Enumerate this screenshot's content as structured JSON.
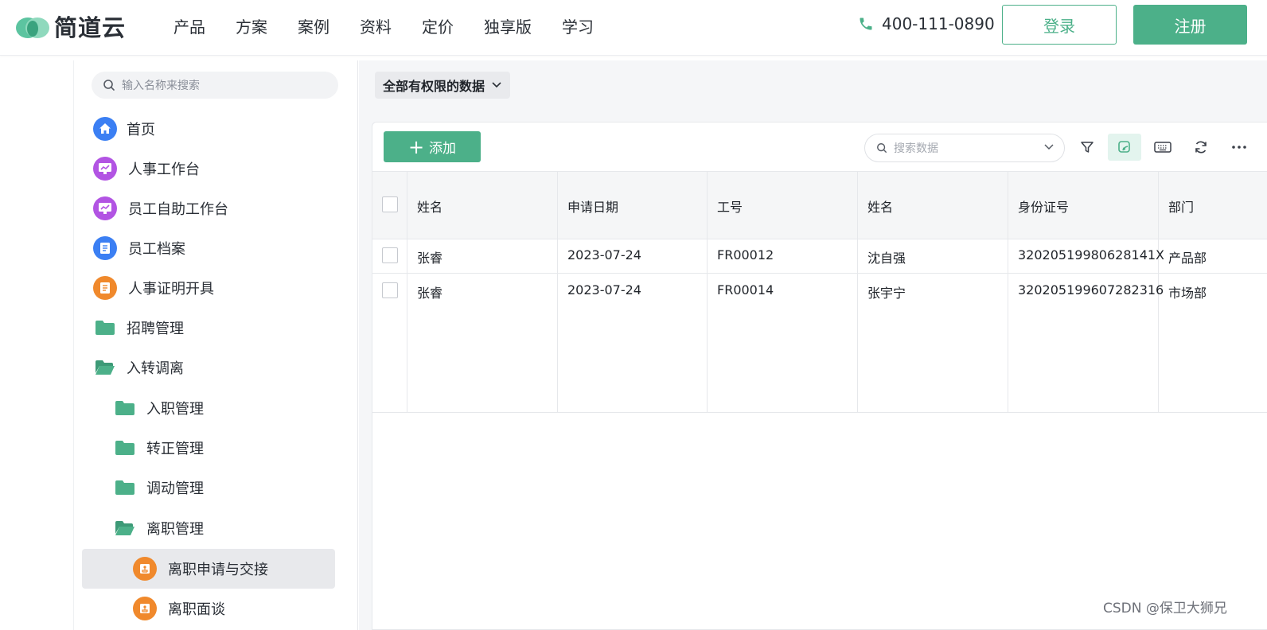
{
  "brand": {
    "name": "简道云"
  },
  "nav": {
    "items": [
      "产品",
      "方案",
      "案例",
      "资料",
      "定价",
      "独享版",
      "学习"
    ]
  },
  "contact": {
    "phone": "400-111-0890"
  },
  "auth": {
    "login": "登录",
    "register": "注册"
  },
  "sidebar": {
    "search_placeholder": "输入名称来搜索",
    "items": [
      {
        "label": "首页",
        "icon": "home-icon",
        "color": "#3b7ff3"
      },
      {
        "label": "人事工作台",
        "icon": "dashboard-icon",
        "color": "#b254e3"
      },
      {
        "label": "员工自助工作台",
        "icon": "dashboard-icon",
        "color": "#b254e3"
      },
      {
        "label": "员工档案",
        "icon": "form-icon",
        "color": "#3b7ff3"
      },
      {
        "label": "人事证明开具",
        "icon": "form-icon",
        "color": "#f0892c"
      },
      {
        "label": "招聘管理",
        "icon": "folder-icon",
        "color": "#4cb089"
      },
      {
        "label": "入转调离",
        "icon": "folder-open-icon",
        "color": "#4cb089"
      },
      {
        "label": "入职管理",
        "icon": "folder-icon",
        "color": "#4cb089"
      },
      {
        "label": "转正管理",
        "icon": "folder-icon",
        "color": "#4cb089"
      },
      {
        "label": "调动管理",
        "icon": "folder-icon",
        "color": "#4cb089"
      },
      {
        "label": "离职管理",
        "icon": "folder-open-icon",
        "color": "#4cb089"
      },
      {
        "label": "离职申请与交接",
        "icon": "flow-icon",
        "color": "#f0892c"
      },
      {
        "label": "离职面谈",
        "icon": "flow-icon",
        "color": "#f0892c"
      }
    ]
  },
  "main": {
    "scope_filter": "全部有权限的数据",
    "add_button": "添加",
    "data_search_placeholder": "搜索数据"
  },
  "table": {
    "columns": [
      "姓名",
      "申请日期",
      "工号",
      "姓名",
      "身份证号",
      "部门"
    ],
    "rows": [
      [
        "张睿",
        "2023-07-24",
        "FR00012",
        "沈自强",
        "32020519980628141X",
        "产品部"
      ],
      [
        "张睿",
        "2023-07-24",
        "FR00014",
        "张宇宁",
        "320205199607282316",
        "市场部"
      ]
    ]
  },
  "watermark": "CSDN @保卫大狮兄",
  "colors": {
    "accent": "#4cb089"
  }
}
